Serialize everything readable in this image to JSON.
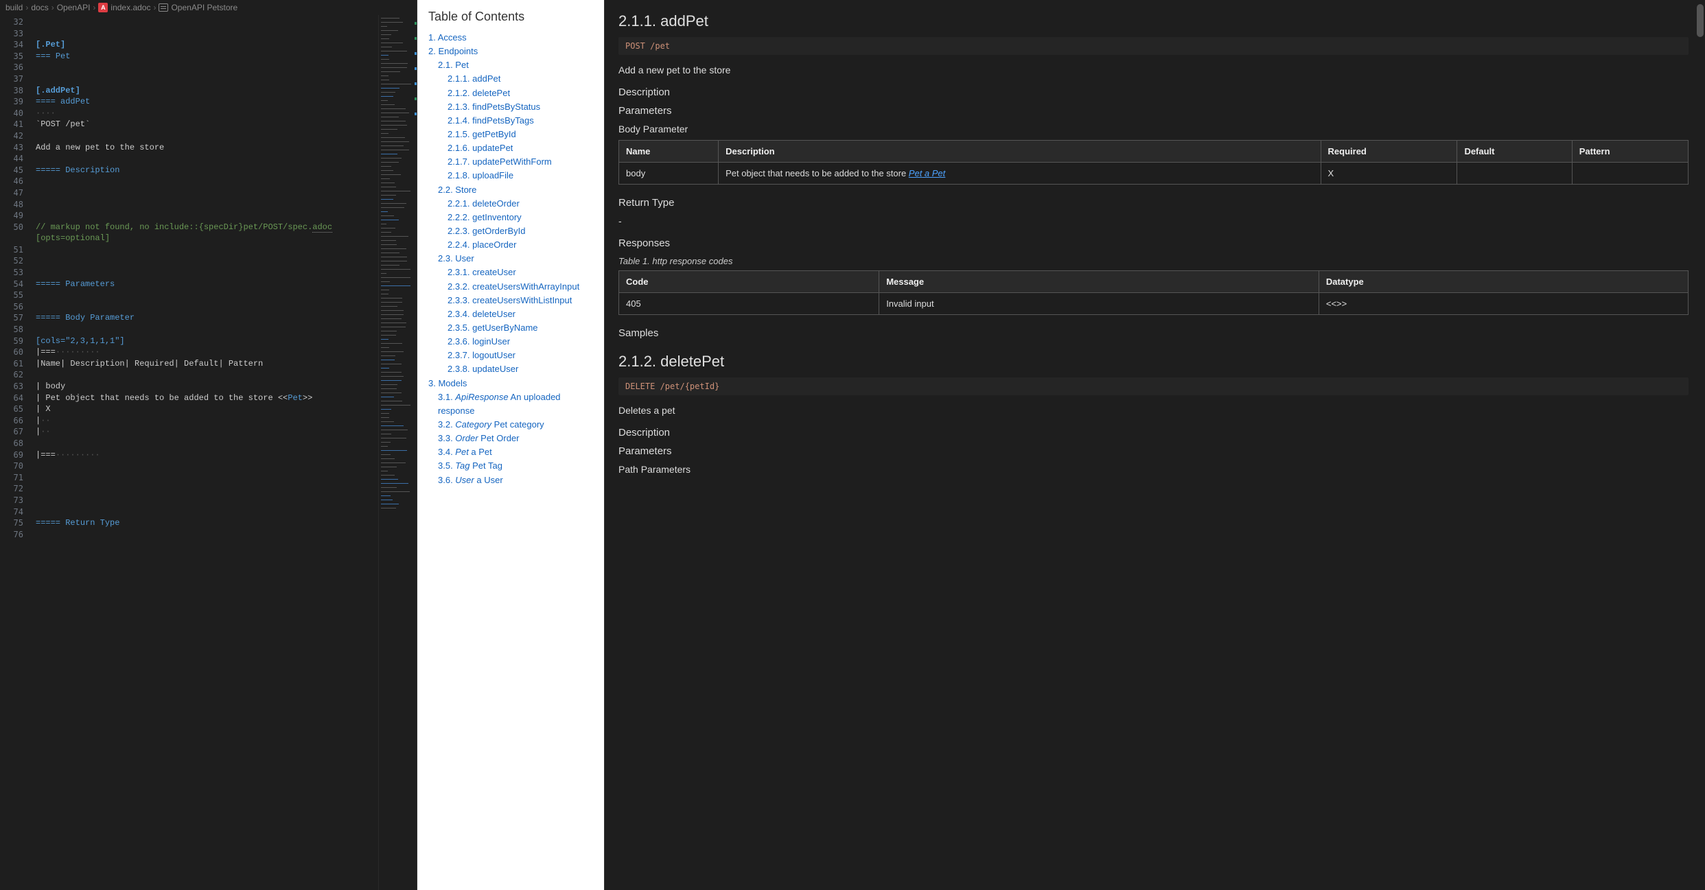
{
  "breadcrumbs": {
    "parts": [
      "build",
      "docs",
      "OpenAPI"
    ],
    "file_label": "index.adoc",
    "file_icon_char": "A",
    "symbol_label": "OpenAPI Petstore"
  },
  "editor": {
    "first_line": 32,
    "lines": [
      {
        "n": 32,
        "seg": [
          {
            "t": "",
            "c": ""
          }
        ]
      },
      {
        "n": 33,
        "seg": [
          {
            "t": "",
            "c": ""
          }
        ]
      },
      {
        "n": 34,
        "seg": [
          {
            "t": "[.Pet]",
            "c": "tok-kw"
          }
        ]
      },
      {
        "n": 35,
        "seg": [
          {
            "t": "=== ",
            "c": "tok-head"
          },
          {
            "t": "Pet",
            "c": "tok-head"
          }
        ]
      },
      {
        "n": 36,
        "seg": [
          {
            "t": "",
            "c": ""
          }
        ]
      },
      {
        "n": 37,
        "seg": [
          {
            "t": "",
            "c": ""
          }
        ]
      },
      {
        "n": 38,
        "seg": [
          {
            "t": "[.addPet]",
            "c": "tok-kw"
          }
        ]
      },
      {
        "n": 39,
        "seg": [
          {
            "t": "==== ",
            "c": "tok-head"
          },
          {
            "t": "addPet",
            "c": "tok-head"
          }
        ]
      },
      {
        "n": 40,
        "seg": [
          {
            "t": "····",
            "c": "tok-dim"
          }
        ]
      },
      {
        "n": 41,
        "seg": [
          {
            "t": "`POST /pet`",
            "c": "tok-str"
          }
        ]
      },
      {
        "n": 42,
        "seg": [
          {
            "t": "",
            "c": ""
          }
        ]
      },
      {
        "n": 43,
        "seg": [
          {
            "t": "Add a new pet to the store",
            "c": "tok-str"
          }
        ]
      },
      {
        "n": 44,
        "seg": [
          {
            "t": "",
            "c": ""
          }
        ]
      },
      {
        "n": 45,
        "seg": [
          {
            "t": "===== ",
            "c": "tok-head"
          },
          {
            "t": "Description",
            "c": "tok-head"
          }
        ]
      },
      {
        "n": 46,
        "seg": [
          {
            "t": "",
            "c": ""
          }
        ]
      },
      {
        "n": 47,
        "seg": [
          {
            "t": "",
            "c": ""
          }
        ]
      },
      {
        "n": 48,
        "seg": [
          {
            "t": "",
            "c": ""
          }
        ]
      },
      {
        "n": 49,
        "seg": [
          {
            "t": "",
            "c": ""
          }
        ]
      },
      {
        "n": 50,
        "seg": [
          {
            "t": "// markup not found, no include::{specDir}pet/POST/spec.",
            "c": "tok-cmt"
          },
          {
            "t": "adoc",
            "c": "tok-cmt underline-dotted"
          },
          {
            "t": "[opts=optional]",
            "c": "tok-cmt",
            "wrap": true
          }
        ]
      },
      {
        "n": 51,
        "seg": [
          {
            "t": "",
            "c": ""
          }
        ]
      },
      {
        "n": 52,
        "seg": [
          {
            "t": "",
            "c": ""
          }
        ]
      },
      {
        "n": 53,
        "seg": [
          {
            "t": "",
            "c": ""
          }
        ]
      },
      {
        "n": 54,
        "seg": [
          {
            "t": "===== ",
            "c": "tok-head"
          },
          {
            "t": "Parameters",
            "c": "tok-head"
          }
        ]
      },
      {
        "n": 55,
        "seg": [
          {
            "t": "",
            "c": ""
          }
        ]
      },
      {
        "n": 56,
        "seg": [
          {
            "t": "",
            "c": ""
          }
        ]
      },
      {
        "n": 57,
        "seg": [
          {
            "t": "===== ",
            "c": "tok-head"
          },
          {
            "t": "Body Parameter",
            "c": "tok-head"
          }
        ]
      },
      {
        "n": 58,
        "seg": [
          {
            "t": "",
            "c": ""
          }
        ]
      },
      {
        "n": 59,
        "seg": [
          {
            "t": "[cols=\"2,3,1,1,1\"]",
            "c": "tok-attr"
          }
        ]
      },
      {
        "n": 60,
        "seg": [
          {
            "t": "|===",
            "c": "tok-str"
          },
          {
            "t": "·········",
            "c": "tok-dim"
          }
        ]
      },
      {
        "n": 61,
        "seg": [
          {
            "t": "|Name| Description| Required| Default| Pattern",
            "c": "tok-str"
          }
        ]
      },
      {
        "n": 62,
        "seg": [
          {
            "t": "",
            "c": ""
          }
        ]
      },
      {
        "n": 63,
        "seg": [
          {
            "t": "| body",
            "c": "tok-str"
          }
        ]
      },
      {
        "n": 64,
        "seg": [
          {
            "t": "| Pet object that needs to be added to the store <<",
            "c": "tok-str"
          },
          {
            "t": "Pet",
            "c": "tok-link"
          },
          {
            "t": ">>",
            "c": "tok-str"
          }
        ]
      },
      {
        "n": 65,
        "seg": [
          {
            "t": "| X",
            "c": "tok-str"
          }
        ]
      },
      {
        "n": 66,
        "seg": [
          {
            "t": "|",
            "c": "tok-str"
          },
          {
            "t": "··",
            "c": "tok-dim"
          }
        ]
      },
      {
        "n": 67,
        "seg": [
          {
            "t": "|",
            "c": "tok-str"
          },
          {
            "t": "··",
            "c": "tok-dim"
          }
        ]
      },
      {
        "n": 68,
        "seg": [
          {
            "t": "",
            "c": ""
          }
        ]
      },
      {
        "n": 69,
        "seg": [
          {
            "t": "|===",
            "c": "tok-str"
          },
          {
            "t": "·········",
            "c": "tok-dim"
          }
        ]
      },
      {
        "n": 70,
        "seg": [
          {
            "t": "",
            "c": ""
          }
        ]
      },
      {
        "n": 71,
        "seg": [
          {
            "t": "",
            "c": ""
          }
        ]
      },
      {
        "n": 72,
        "seg": [
          {
            "t": "",
            "c": ""
          }
        ]
      },
      {
        "n": 73,
        "seg": [
          {
            "t": "",
            "c": ""
          }
        ]
      },
      {
        "n": 74,
        "seg": [
          {
            "t": "",
            "c": ""
          }
        ]
      },
      {
        "n": 75,
        "seg": [
          {
            "t": "===== ",
            "c": "tok-head"
          },
          {
            "t": "Return Type",
            "c": "tok-head"
          }
        ]
      },
      {
        "n": 76,
        "seg": [
          {
            "t": "",
            "c": ""
          }
        ]
      }
    ]
  },
  "toc": {
    "title": "Table of Contents",
    "items": [
      {
        "level": 1,
        "prefix": "1.",
        "text": "Access"
      },
      {
        "level": 1,
        "prefix": "2.",
        "text": "Endpoints"
      },
      {
        "level": 2,
        "prefix": "2.1.",
        "text": "Pet"
      },
      {
        "level": 3,
        "prefix": "2.1.1.",
        "text": "addPet"
      },
      {
        "level": 3,
        "prefix": "2.1.2.",
        "text": "deletePet"
      },
      {
        "level": 3,
        "prefix": "2.1.3.",
        "text": "findPetsByStatus"
      },
      {
        "level": 3,
        "prefix": "2.1.4.",
        "text": "findPetsByTags"
      },
      {
        "level": 3,
        "prefix": "2.1.5.",
        "text": "getPetById"
      },
      {
        "level": 3,
        "prefix": "2.1.6.",
        "text": "updatePet"
      },
      {
        "level": 3,
        "prefix": "2.1.7.",
        "text": "updatePetWithForm"
      },
      {
        "level": 3,
        "prefix": "2.1.8.",
        "text": "uploadFile"
      },
      {
        "level": 2,
        "prefix": "2.2.",
        "text": "Store"
      },
      {
        "level": 3,
        "prefix": "2.2.1.",
        "text": "deleteOrder"
      },
      {
        "level": 3,
        "prefix": "2.2.2.",
        "text": "getInventory"
      },
      {
        "level": 3,
        "prefix": "2.2.3.",
        "text": "getOrderById"
      },
      {
        "level": 3,
        "prefix": "2.2.4.",
        "text": "placeOrder"
      },
      {
        "level": 2,
        "prefix": "2.3.",
        "text": "User"
      },
      {
        "level": 3,
        "prefix": "2.3.1.",
        "text": "createUser"
      },
      {
        "level": 3,
        "prefix": "2.3.2.",
        "text": "createUsersWithArrayInput"
      },
      {
        "level": 3,
        "prefix": "2.3.3.",
        "text": "createUsersWithListInput"
      },
      {
        "level": 3,
        "prefix": "2.3.4.",
        "text": "deleteUser"
      },
      {
        "level": 3,
        "prefix": "2.3.5.",
        "text": "getUserByName"
      },
      {
        "level": 3,
        "prefix": "2.3.6.",
        "text": "loginUser"
      },
      {
        "level": 3,
        "prefix": "2.3.7.",
        "text": "logoutUser"
      },
      {
        "level": 3,
        "prefix": "2.3.8.",
        "text": "updateUser"
      },
      {
        "level": 1,
        "prefix": "3.",
        "text": "Models"
      },
      {
        "level": 2,
        "prefix": "3.1.",
        "em": "ApiResponse",
        "tail": " An uploaded response"
      },
      {
        "level": 2,
        "prefix": "3.2.",
        "em": "Category",
        "tail": " Pet category"
      },
      {
        "level": 2,
        "prefix": "3.3.",
        "em": "Order",
        "tail": " Pet Order"
      },
      {
        "level": 2,
        "prefix": "3.4.",
        "em": "Pet",
        "tail": " a Pet"
      },
      {
        "level": 2,
        "prefix": "3.5.",
        "em": "Tag",
        "tail": " Pet Tag"
      },
      {
        "level": 2,
        "prefix": "3.6.",
        "em": "User",
        "tail": " a User"
      }
    ]
  },
  "content": {
    "addPet": {
      "heading": "2.1.1. addPet",
      "route": "POST /pet",
      "summary": "Add a new pet to the store",
      "desc_label": "Description",
      "params_label": "Parameters",
      "body_label": "Body Parameter",
      "table": {
        "head": [
          "Name",
          "Description",
          "Required",
          "Default",
          "Pattern"
        ],
        "rows": [
          {
            "name": "body",
            "desc_prefix": "Pet object that needs to be added to the store ",
            "link_em": "Pet",
            "link_tail": " a Pet",
            "required": "X",
            "default": "",
            "pattern": ""
          }
        ]
      },
      "return_label": "Return Type",
      "return_value": "-",
      "responses_label": "Responses",
      "responses_caption": "Table 1. http response codes",
      "responses": {
        "head": [
          "Code",
          "Message",
          "Datatype"
        ],
        "rows": [
          {
            "code": "405",
            "message": "Invalid input",
            "datatype": "<<>>"
          }
        ]
      },
      "samples_label": "Samples"
    },
    "deletePet": {
      "heading": "2.1.2. deletePet",
      "route": "DELETE /pet/{petId}",
      "summary": "Deletes a pet",
      "desc_label": "Description",
      "params_label": "Parameters",
      "path_label": "Path Parameters"
    }
  }
}
